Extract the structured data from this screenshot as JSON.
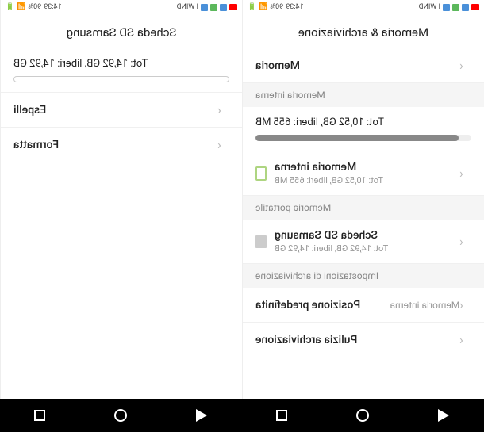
{
  "status": {
    "carrier": "I WIND",
    "time": "14:39",
    "battery": "90%"
  },
  "right_screen": {
    "title": "Memoria & archiviazione",
    "memory_row": "Memoria",
    "section_internal": "Memoria interna",
    "internal_total": "Tot: 10,52 GB, liberi: 655 MB",
    "internal_progress": 94,
    "internal_item_title": "Memoria interna",
    "internal_item_sub": "Tot: 10,52 GB, liberi: 655 MB",
    "section_portable": "Memoria portatile",
    "sd_title": "Scheda SD Samsung",
    "sd_sub": "Tot: 14,92 GB, liberi: 14,92 GB",
    "section_settings": "Impostazioni di archiviazione",
    "default_location_label": "Posizione predefinita",
    "default_location_value": "Memoria interna",
    "cleanup": "Pulizia archiviazione"
  },
  "left_screen": {
    "title": "Scheda SD Samsung",
    "total_text": "Tot: 14,92 GB, liberi: 14,92 GB",
    "progress": 0,
    "eject": "Espelli",
    "format": "Formatta"
  },
  "nav": {
    "back": "back",
    "home": "home",
    "recent": "recent"
  }
}
